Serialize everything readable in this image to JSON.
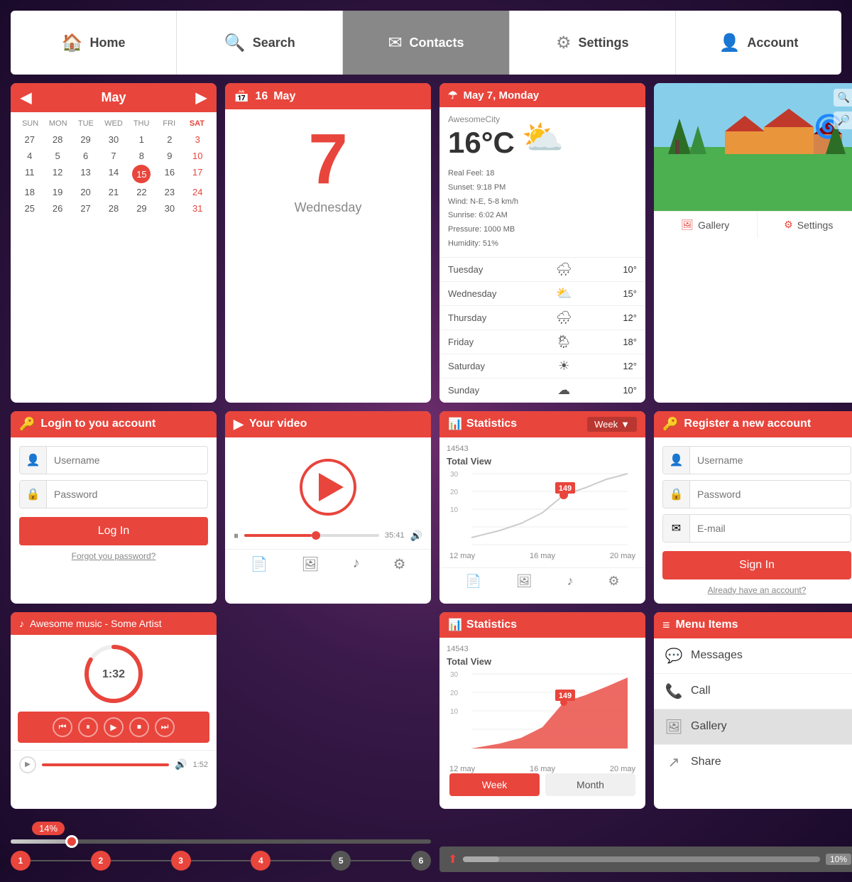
{
  "navbar": {
    "items": [
      {
        "id": "home",
        "label": "Home",
        "icon": "🏠",
        "active": false
      },
      {
        "id": "search",
        "label": "Search",
        "icon": "🔍",
        "active": false
      },
      {
        "id": "contacts",
        "label": "Contacts",
        "icon": "✉",
        "active": true
      },
      {
        "id": "settings",
        "label": "Settings",
        "icon": "⚙",
        "active": false
      },
      {
        "id": "account",
        "label": "Account",
        "icon": "👤",
        "active": false
      }
    ]
  },
  "calendar": {
    "month": "May",
    "days_header": [
      "SUN",
      "MON",
      "TUE",
      "WED",
      "THU",
      "FRI",
      "SAT"
    ],
    "rows": [
      [
        "27",
        "28",
        "29",
        "30",
        "1",
        "2",
        "3"
      ],
      [
        "4",
        "5",
        "6",
        "7",
        "8",
        "9",
        "10"
      ],
      [
        "11",
        "12",
        "13",
        "14",
        "15",
        "16",
        "17"
      ],
      [
        "18",
        "19",
        "20",
        "21",
        "22",
        "23",
        "24"
      ],
      [
        "25",
        "26",
        "27",
        "28",
        "29",
        "30",
        "31"
      ]
    ],
    "today": "15"
  },
  "date_widget": {
    "header_icon": "📅",
    "month": "May",
    "day_number": "7",
    "day_name": "Wednesday",
    "header_num": "16"
  },
  "weather": {
    "header_icon": "☂",
    "title": "May 7, Monday",
    "city": "AwesomeCity",
    "temp": "16°C",
    "real_feel": "Real Feel: 18",
    "wind": "Wind: N-E, 5-8 km/h",
    "sunrise": "Sunrise: 6:02 AM",
    "sunset": "Sunset: 9:18 PM",
    "pressure": "Pressure: 1000 MB",
    "humidity": "Humidity: 51%",
    "forecast": [
      {
        "day": "Tuesday",
        "icon": "🌧",
        "temp": "10°"
      },
      {
        "day": "Wednesday",
        "icon": "⛅",
        "temp": "15°"
      },
      {
        "day": "Thursday",
        "icon": "🌧",
        "temp": "12°"
      },
      {
        "day": "Friday",
        "icon": "🌦",
        "temp": "18°"
      },
      {
        "day": "Saturday",
        "icon": "☀",
        "temp": "12°"
      },
      {
        "day": "Sunday",
        "icon": "☁",
        "temp": "10°"
      }
    ]
  },
  "gallery_settings": {
    "gallery_label": "Gallery",
    "settings_label": "Settings"
  },
  "login": {
    "header_icon": "🔑",
    "title": "Login to you account",
    "username_placeholder": "Username",
    "password_placeholder": "Password",
    "button_label": "Log In",
    "forgot_label": "Forgot you password?"
  },
  "video": {
    "header_icon": "▶",
    "title": "Your video",
    "time": "35:41",
    "icons": [
      "📄",
      "🖼",
      "♪",
      "⚙"
    ]
  },
  "stats_chart": {
    "header_icon": "📊",
    "title": "Statistics",
    "week_label": "Week",
    "total_label": "14543",
    "total_sub": "Total View",
    "peak_label": "149",
    "dates": [
      "12 may",
      "16 may",
      "20 may"
    ],
    "icons": [
      "📄",
      "🖼",
      "♪",
      "⚙"
    ]
  },
  "music": {
    "header_icon": "♪",
    "title": "Awesome music - Some Artist",
    "time": "1:32",
    "controls": [
      "⏮",
      "⏸",
      "▶",
      "⏹",
      "⏭"
    ]
  },
  "slider": {
    "percent": "14%",
    "steps": [
      "1",
      "2",
      "3",
      "4",
      "5",
      "6"
    ]
  },
  "stats2": {
    "header_icon": "📊",
    "title": "Statistics",
    "total_label": "14543",
    "total_sub": "Total View",
    "peak_label": "149",
    "dates": [
      "12 may",
      "16 may",
      "20 may"
    ],
    "btn_week": "Week",
    "btn_month": "Month"
  },
  "progress": {
    "icon": "⬆",
    "percent": "10%"
  },
  "register": {
    "header_icon": "🔑",
    "title": "Register a new account",
    "username_placeholder": "Username",
    "password_placeholder": "Password",
    "email_placeholder": "E-mail",
    "button_label": "Sign In",
    "already_label": "Already have an account?"
  },
  "menu": {
    "header_icon": "≡",
    "title": "Menu Items",
    "items": [
      {
        "icon": "💬",
        "label": "Messages"
      },
      {
        "icon": "📞",
        "label": "Call"
      },
      {
        "icon": "🖼",
        "label": "Gallery",
        "active": true
      },
      {
        "icon": "↗",
        "label": "Share"
      }
    ]
  },
  "colors": {
    "accent": "#e8453c",
    "bg": "#3a1a4a",
    "card_bg": "#ffffff"
  }
}
